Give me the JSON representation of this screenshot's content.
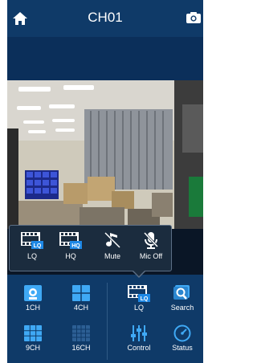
{
  "header": {
    "title": "CH01",
    "home_icon": "home-icon",
    "snapshot_icon": "camera-icon"
  },
  "popup_menu": {
    "items": [
      {
        "label": "LQ",
        "icon": "film-lq-icon"
      },
      {
        "label": "HQ",
        "icon": "film-hq-icon"
      },
      {
        "label": "Mute",
        "icon": "music-mute-icon"
      },
      {
        "label": "Mic Off",
        "icon": "mic-off-icon"
      }
    ],
    "lq_badge": "LQ",
    "hq_badge": "HQ"
  },
  "bottom_bar": {
    "left": [
      {
        "label": "1CH",
        "icon": "single-channel-icon"
      },
      {
        "label": "4CH",
        "icon": "quad-channel-icon"
      },
      {
        "label": "9CH",
        "icon": "nine-channel-icon"
      },
      {
        "label": "16CH",
        "icon": "sixteen-channel-icon"
      }
    ],
    "right": [
      {
        "label": "LQ",
        "icon": "film-lq-icon"
      },
      {
        "label": "Search",
        "icon": "search-icon"
      },
      {
        "label": "Control",
        "icon": "control-sliders-icon"
      },
      {
        "label": "Status",
        "icon": "status-gauge-icon"
      }
    ],
    "lq_badge": "LQ"
  },
  "colors": {
    "header_bg": "#0f3a68",
    "accent": "#1e88e5",
    "popup_bg": "#1b2c3e"
  }
}
